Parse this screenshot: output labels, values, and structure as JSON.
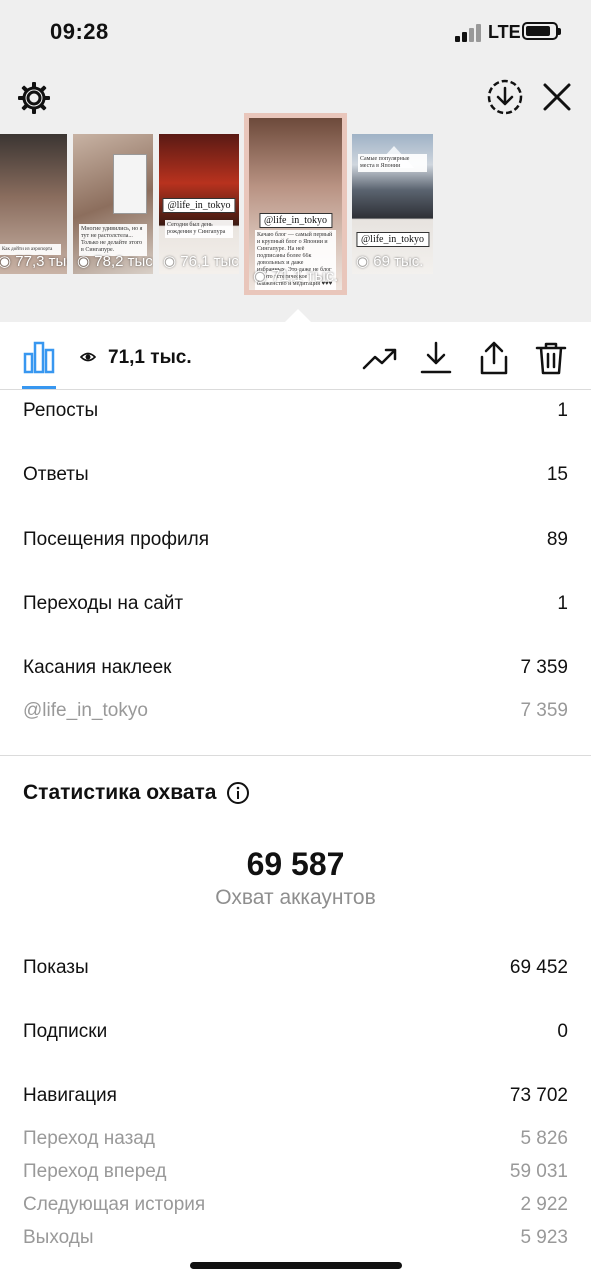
{
  "status_bar": {
    "time": "09:28",
    "network": "LTE"
  },
  "stories": [
    {
      "views": "77,3 тыс.",
      "handle": "",
      "caption": "Как дойти из аэропорта"
    },
    {
      "views": "78,2 тыс.",
      "handle": "",
      "caption": "Многие удивились, но я тут не растолстела... Только не делайте этого в Сингапуре."
    },
    {
      "views": "76,1 тыс.",
      "handle": "@life_in_tokyo",
      "caption": "Сегодня был день рождения у Сингапура"
    },
    {
      "views": "71,1 тыс.",
      "handle": "@life_in_tokyo",
      "caption": "Качаю блог — самый первый и крупный блог о Японии и Сингапуре. На неё подписаны более 66к довольных и даже избранных. Это даже не блог — это эстетическое блаженство и медитация ♥♥♥"
    },
    {
      "views": "69 тыс.",
      "handle": "@life_in_tokyo",
      "caption": "Самые популярные места в Японии"
    }
  ],
  "toolbar": {
    "views": "71,1 тыс."
  },
  "interactions": [
    {
      "label": "Репосты",
      "value": "1"
    },
    {
      "label": "Ответы",
      "value": "15"
    },
    {
      "label": "Посещения профиля",
      "value": "89"
    },
    {
      "label": "Переходы на сайт",
      "value": "1"
    },
    {
      "label": "Касания наклеек",
      "value": "7 359"
    }
  ],
  "sticker_detail": {
    "label": "@life_in_tokyo",
    "value": "7 359"
  },
  "reach": {
    "title": "Статистика охвата",
    "accounts_reached": "69 587",
    "accounts_reached_label": "Охват аккаунтов",
    "impressions": {
      "label": "Показы",
      "value": "69 452"
    },
    "follows": {
      "label": "Подписки",
      "value": "0"
    },
    "navigation": {
      "label": "Навигация",
      "value": "73 702"
    },
    "navigation_details": [
      {
        "label": "Переход назад",
        "value": "5 826"
      },
      {
        "label": "Переход вперед",
        "value": "59 031"
      },
      {
        "label": "Следующая история",
        "value": "2 922"
      },
      {
        "label": "Выходы",
        "value": "5 923"
      }
    ]
  },
  "colors": {
    "accent": "#3897f0",
    "muted": "#8e8e8e",
    "header_bg": "#efefef"
  }
}
